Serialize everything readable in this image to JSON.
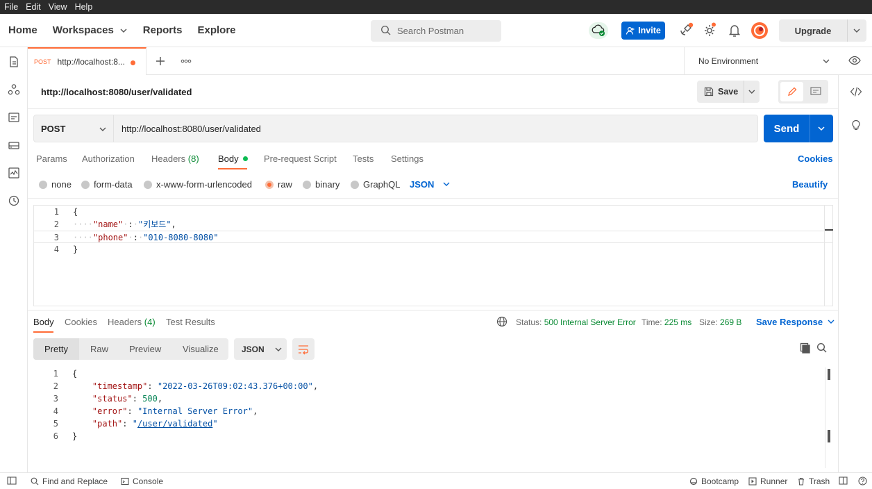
{
  "menubar": {
    "file": "File",
    "edit": "Edit",
    "view": "View",
    "help": "Help"
  },
  "header": {
    "home": "Home",
    "workspaces": "Workspaces",
    "reports": "Reports",
    "explore": "Explore",
    "search_placeholder": "Search Postman",
    "invite": "Invite",
    "upgrade": "Upgrade"
  },
  "tab": {
    "method": "POST",
    "label": "http://localhost:8..."
  },
  "environment": "No Environment",
  "request": {
    "title": "http://localhost:8080/user/validated",
    "save": "Save",
    "method": "POST",
    "url": "http://localhost:8080/user/validated",
    "send": "Send"
  },
  "request_tabs": {
    "params": "Params",
    "authorization": "Authorization",
    "headers": "Headers",
    "headers_count": "(8)",
    "body": "Body",
    "prerequest": "Pre-request Script",
    "tests": "Tests",
    "settings": "Settings",
    "cookies": "Cookies"
  },
  "body_types": {
    "none": "none",
    "form_data": "form-data",
    "urlencoded": "x-www-form-urlencoded",
    "raw": "raw",
    "binary": "binary",
    "graphql": "GraphQL",
    "format": "JSON",
    "beautify": "Beautify"
  },
  "request_body": {
    "l1": "{",
    "name_key": "\"name\"",
    "name_val": "\"키보드\"",
    "phone_key": "\"phone\"",
    "phone_val": "\"010-8080-8080\"",
    "l4": "}"
  },
  "response_tabs": {
    "body": "Body",
    "cookies": "Cookies",
    "headers": "Headers",
    "headers_count": "(4)",
    "test_results": "Test Results"
  },
  "response_meta": {
    "status_label": "Status:",
    "status_value": "500 Internal Server Error",
    "time_label": "Time:",
    "time_value": "225 ms",
    "size_label": "Size:",
    "size_value": "269 B",
    "save_response": "Save Response"
  },
  "response_view": {
    "pretty": "Pretty",
    "raw": "Raw",
    "preview": "Preview",
    "visualize": "Visualize",
    "format": "JSON"
  },
  "response_body": {
    "open": "{",
    "timestamp_key": "\"timestamp\"",
    "timestamp_val": "\"2022-03-26T09:02:43.376+00:00\"",
    "status_key": "\"status\"",
    "status_val": "500",
    "error_key": "\"error\"",
    "error_val": "\"Internal Server Error\"",
    "path_key": "\"path\"",
    "path_val": "/user/validated",
    "close": "}"
  },
  "footer": {
    "find_replace": "Find and Replace",
    "console": "Console",
    "bootcamp": "Bootcamp",
    "runner": "Runner",
    "trash": "Trash"
  },
  "colors": {
    "accent": "#ff6c37",
    "primary": "#0265d2",
    "success": "#0a8a34"
  }
}
